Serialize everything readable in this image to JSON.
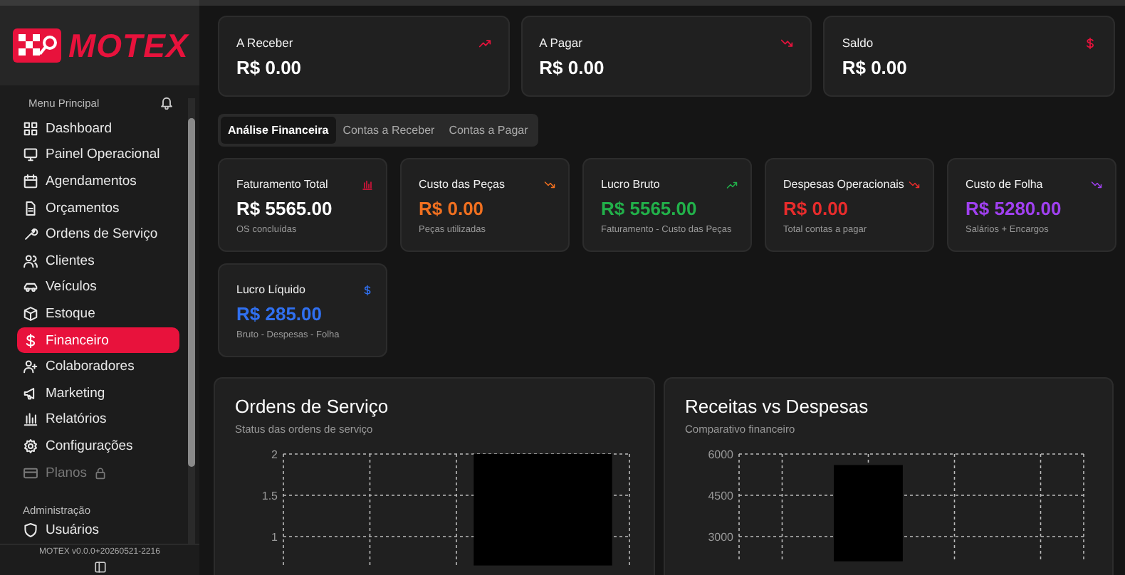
{
  "sidebar": {
    "logo": "MOTEX",
    "section_title": "Menu Principal",
    "items": [
      {
        "label": "Dashboard",
        "selected": false,
        "locked": false
      },
      {
        "label": "Painel Operacional",
        "selected": false,
        "locked": false
      },
      {
        "label": "Agendamentos",
        "selected": false,
        "locked": false
      },
      {
        "label": "Orçamentos",
        "selected": false,
        "locked": false
      },
      {
        "label": "Ordens de Serviço",
        "selected": false,
        "locked": false
      },
      {
        "label": "Clientes",
        "selected": false,
        "locked": false
      },
      {
        "label": "Veículos",
        "selected": false,
        "locked": false
      },
      {
        "label": "Estoque",
        "selected": false,
        "locked": false
      },
      {
        "label": "Financeiro",
        "selected": true,
        "locked": false
      },
      {
        "label": "Colaboradores",
        "selected": false,
        "locked": false
      },
      {
        "label": "Marketing",
        "selected": false,
        "locked": false
      },
      {
        "label": "Relatórios",
        "selected": false,
        "locked": false
      },
      {
        "label": "Configurações",
        "selected": false,
        "locked": false
      },
      {
        "label": "Planos",
        "selected": false,
        "locked": true
      }
    ],
    "admin_title": "Administração",
    "admin_items": [
      {
        "label": "Usuários",
        "selected": false
      }
    ],
    "version": "MOTEX v0.0.0+20260521-2216"
  },
  "summary_cards": [
    {
      "label": "A Receber",
      "value": "R$ 0.00"
    },
    {
      "label": "A Pagar",
      "value": "R$ 0.00"
    },
    {
      "label": "Saldo",
      "value": "R$ 0.00"
    }
  ],
  "tabs": [
    {
      "label": "Análise Financeira",
      "selected": true
    },
    {
      "label": "Contas a Receber",
      "selected": false
    },
    {
      "label": "Contas a Pagar",
      "selected": false
    }
  ],
  "kpis": [
    {
      "label": "Faturamento Total",
      "value": "R$ 5565.00",
      "note": "OS concluídas",
      "color": "#ffffff"
    },
    {
      "label": "Custo das Peças",
      "value": "R$ 0.00",
      "note": "Peças utilizadas",
      "color": "#f07020"
    },
    {
      "label": "Lucro Bruto",
      "value": "R$ 5565.00",
      "note": "Faturamento - Custo das Peças",
      "color": "#22b04a"
    },
    {
      "label": "Despesas Operacionais",
      "value": "R$ 0.00",
      "note": "Total contas a pagar",
      "color": "#e82c2c"
    },
    {
      "label": "Custo de Folha",
      "value": "R$ 5280.00",
      "note": "Salários + Encargos",
      "color": "#a040f0"
    },
    {
      "label": "Lucro Líquido",
      "value": "R$ 285.00",
      "note": "Bruto - Despesas - Folha",
      "color": "#3070f0"
    }
  ],
  "charts": [
    {
      "title": "Ordens de Serviço",
      "subtitle": "Status das ordens de serviço",
      "chart_data": {
        "type": "bar",
        "values": [
          null,
          2
        ],
        "ylim": [
          0.65,
          2
        ],
        "grid": true,
        "yticks": [
          1,
          1.5,
          2
        ]
      }
    },
    {
      "title": "Receitas vs Despesas",
      "subtitle": "Comparativo financeiro",
      "chart_data": {
        "type": "bar",
        "values": [
          null,
          5600,
          null,
          null
        ],
        "ylim": [
          2100,
          6000
        ],
        "grid": true,
        "yticks": [
          3000,
          4500,
          6000
        ]
      }
    }
  ]
}
